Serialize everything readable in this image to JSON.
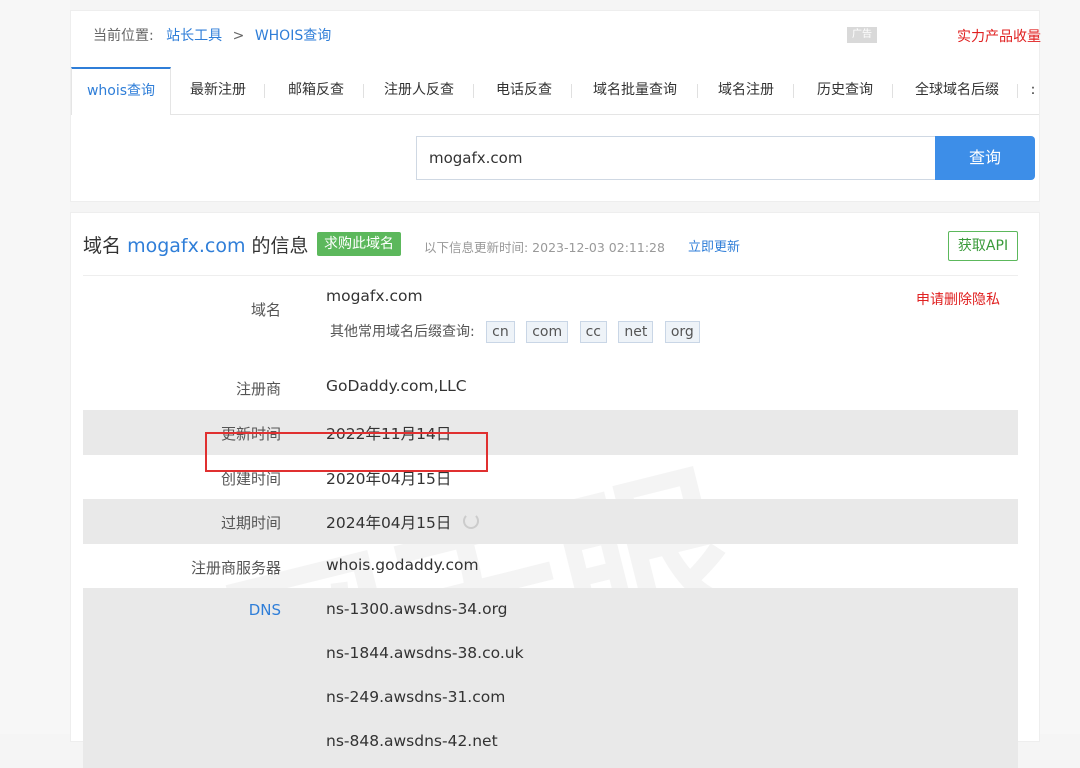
{
  "breadcrumb": {
    "prefix": "当前位置:",
    "items": [
      "站长工具",
      "WHOIS查询"
    ],
    "separator": ">"
  },
  "ad": {
    "badge": "广告",
    "right_text": "实力产品收量"
  },
  "tabs": [
    {
      "label": "whois查询",
      "active": true
    },
    {
      "label": "最新注册"
    },
    {
      "label": "邮箱反查"
    },
    {
      "label": "注册人反查"
    },
    {
      "label": "电话反查"
    },
    {
      "label": "域名批量查询"
    },
    {
      "label": "域名注册"
    },
    {
      "label": "历史查询"
    },
    {
      "label": "全球域名后缀"
    },
    {
      "label": ":"
    }
  ],
  "search": {
    "value": "mogafx.com",
    "button_label": "查询"
  },
  "info": {
    "title_prefix": "域名",
    "title_domain": "mogafx.com",
    "title_suffix": "的信息",
    "buy_label": "求购此域名",
    "update_text": "以下信息更新时间: 2023-12-03 02:11:28",
    "update_link": "立即更新",
    "api_label": "获取API",
    "privacy_link": "申请删除隐私",
    "suffix_prompt": "其他常用域名后缀查询:",
    "suffixes": [
      "cn",
      "com",
      "cc",
      "net",
      "org"
    ]
  },
  "rows": {
    "domain": {
      "label": "域名",
      "value": "mogafx.com"
    },
    "registrar": {
      "label": "注册商",
      "value": "GoDaddy.com,LLC"
    },
    "updated": {
      "label": "更新时间",
      "value": "2022年11月14日"
    },
    "created": {
      "label": "创建时间",
      "value": "2020年04月15日"
    },
    "expires": {
      "label": "过期时间",
      "value": "2024年04月15日"
    },
    "whois_server": {
      "label": "注册商服务器",
      "value": "whois.godaddy.com"
    },
    "dns": {
      "label": "DNS",
      "values": [
        "ns-1300.awsdns-34.org",
        "ns-1844.awsdns-38.co.uk",
        "ns-249.awsdns-31.com",
        "ns-848.awsdns-42.net"
      ]
    }
  },
  "watermark": "网天眼",
  "colors": {
    "accent": "#2f7ed8",
    "search_button": "#3d8ee8",
    "buy_badge": "#5cb85c",
    "alert": "#e02020",
    "row_shade": "#e9e9e9"
  }
}
